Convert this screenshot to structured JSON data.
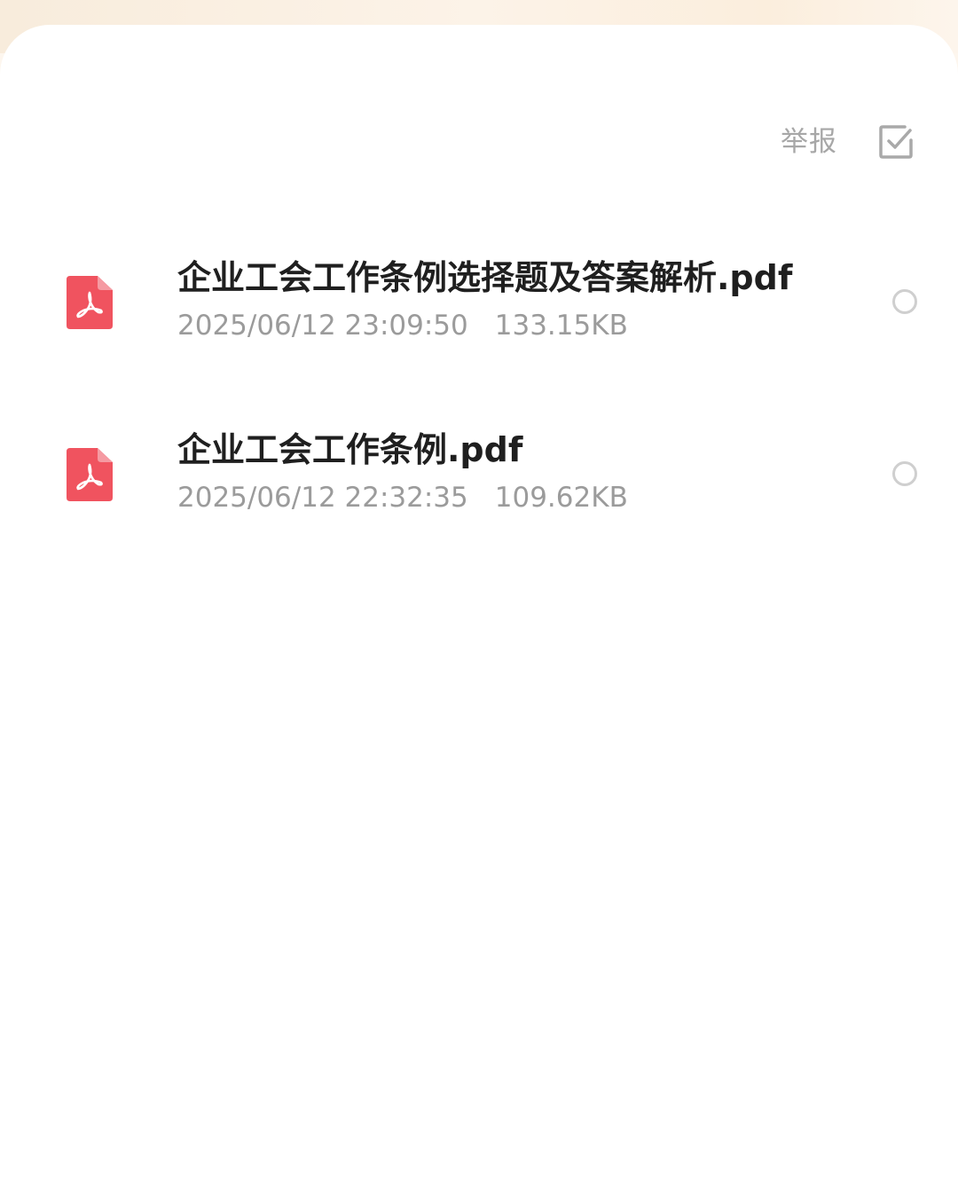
{
  "toolbar": {
    "report_label": "举报",
    "multiselect_icon": "checkbox-check-icon"
  },
  "files": [
    {
      "name": "企业工会工作条例选择题及答案解析.pdf",
      "date": "2025/06/12 23:09:50",
      "size": "133.15KB",
      "icon": "pdf-file-icon",
      "selected": false
    },
    {
      "name": "企业工会工作条例.pdf",
      "date": "2025/06/12 22:32:35",
      "size": "109.62KB",
      "icon": "pdf-file-icon",
      "selected": false
    }
  ],
  "colors": {
    "pdf_icon": "#f0535f",
    "name_text": "#1f1f1f",
    "meta_text": "#9b9b9b",
    "report_text": "#a7a7a7",
    "radio_border": "#cfcfcf",
    "header_tint": "#fbf0e2"
  }
}
